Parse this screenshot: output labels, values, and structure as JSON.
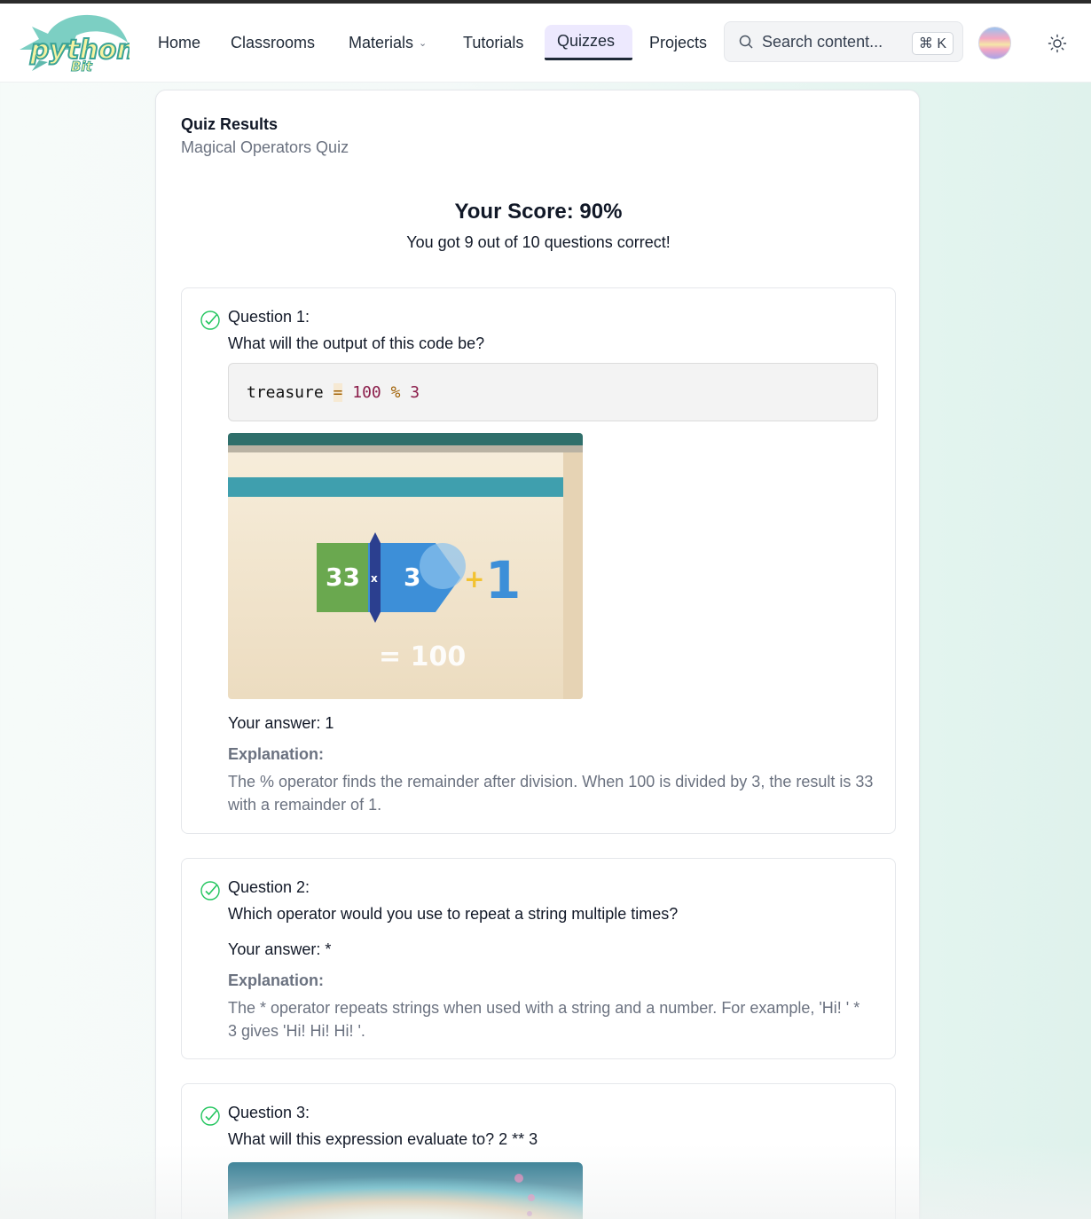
{
  "nav": {
    "brand": "python Bit",
    "items": [
      {
        "label": "Home"
      },
      {
        "label": "Classrooms"
      },
      {
        "label": "Materials"
      },
      {
        "label": "Tutorials"
      },
      {
        "label": "Quizzes",
        "active": true
      },
      {
        "label": "Projects"
      }
    ],
    "search": {
      "placeholder": "Search content...",
      "shortcut": "⌘ K"
    }
  },
  "results": {
    "title": "Quiz Results",
    "quiz_name": "Magical Operators Quiz",
    "score_line": "Your Score: 90%",
    "summary": "You got 9 out of 10 questions correct!"
  },
  "questions": [
    {
      "title": "Question 1:",
      "text": "What will the output of this code be?",
      "code": {
        "var": "treasure",
        "op1": "=",
        "num1": "100",
        "op2": "%",
        "num2": "3"
      },
      "illustration": {
        "left": "33",
        "mult": "x",
        "right": "3",
        "plus": "+",
        "remainder": "1",
        "result": "= 100"
      },
      "answer": "Your answer: 1",
      "explanation_label": "Explanation:",
      "explanation": "The % operator finds the remainder after division. When 100 is divided by 3, the result is 33 with a remainder of 1."
    },
    {
      "title": "Question 2:",
      "text": "Which operator would you use to repeat a string multiple times?",
      "answer": "Your answer: *",
      "explanation_label": "Explanation:",
      "explanation": "The * operator repeats strings when used with a string and a number. For example, 'Hi! ' * 3 gives 'Hi! Hi! Hi! '."
    },
    {
      "title": "Question 3:",
      "text": "What will this expression evaluate to? 2 ** 3"
    }
  ],
  "colors": {
    "accent": "#ede9fe",
    "check": "#22c55e",
    "muted": "#6b7280"
  }
}
